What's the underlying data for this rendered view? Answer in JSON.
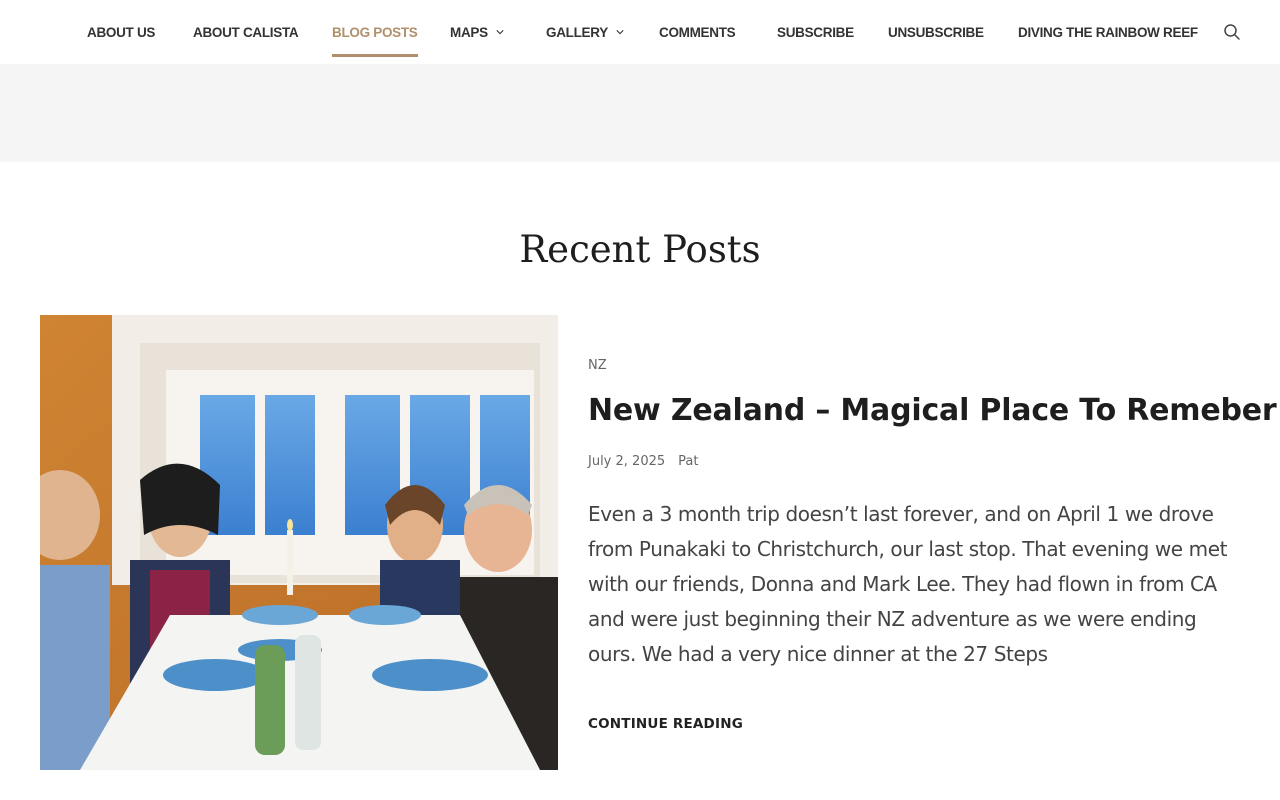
{
  "nav": {
    "items": [
      {
        "label": "ABOUT US"
      },
      {
        "label": "ABOUT CALISTA"
      },
      {
        "label": "BLOG POSTS",
        "active": true
      },
      {
        "label": "MAPS",
        "has_submenu": true
      },
      {
        "label": "GALLERY",
        "has_submenu": true
      },
      {
        "label": "COMMENTS"
      },
      {
        "label": "SUBSCRIBE"
      },
      {
        "label": "UNSUBSCRIBE"
      },
      {
        "label": "DIVING THE RAINBOW REEF"
      }
    ],
    "search_icon": "search-icon",
    "active_color": "#b0906a"
  },
  "main": {
    "section_title": "Recent Posts",
    "posts": [
      {
        "category": "NZ",
        "title": "New Zealand – Magical Place To Remeber",
        "date": "July 2, 2025",
        "author": "Pat",
        "excerpt": "Even a 3 month trip doesn’t last forever, and on April 1 we drove from Punakaki to Christchurch, our last stop. That evening we met with our friends, Donna and Mark Lee. They had flown in from CA and were just beginning their NZ adventure as we were ending ours. We had a very nice dinner at the 27 Steps",
        "continue_label": "CONTINUE READING"
      }
    ]
  }
}
